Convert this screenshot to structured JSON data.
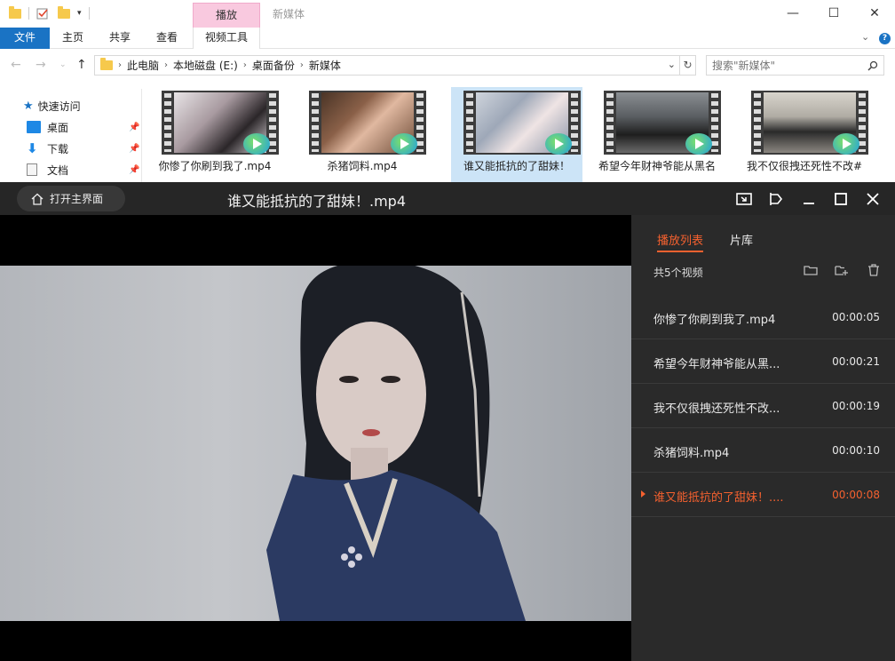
{
  "explorer": {
    "window_title": "新媒体",
    "context_tab": "播放",
    "ribbon_tabs": {
      "file": "文件",
      "home": "主页",
      "share": "共享",
      "view": "查看",
      "video_tools": "视频工具"
    },
    "breadcrumb": [
      "此电脑",
      "本地磁盘 (E:)",
      "桌面备份",
      "新媒体"
    ],
    "search_placeholder": "搜索\"新媒体\"",
    "nav": {
      "quick_access": "快速访问",
      "desktop": "桌面",
      "downloads": "下载",
      "documents": "文档"
    },
    "files": [
      {
        "label": "你惨了你刷到我了.mp4"
      },
      {
        "label": "杀猪饲料.mp4"
      },
      {
        "label": "谁又能抵抗的了甜妹！"
      },
      {
        "label": "希望今年财神爷能从黑名"
      },
      {
        "label": "我不仅很拽还死性不改#"
      }
    ]
  },
  "player": {
    "home_button": "打开主界面",
    "title": "谁又能抵抗的了甜妹！.mp4",
    "tabs": {
      "playlist": "播放列表",
      "library": "片库"
    },
    "count_text": "共5个视频",
    "playlist": [
      {
        "name": "你惨了你刷到我了.mp4",
        "duration": "00:00:05"
      },
      {
        "name": "希望今年财神爷能从黑...",
        "duration": "00:00:21"
      },
      {
        "name": "我不仅很拽还死性不改...",
        "duration": "00:00:19"
      },
      {
        "name": "杀猪饲料.mp4",
        "duration": "00:00:10"
      },
      {
        "name": "谁又能抵抗的了甜妹！....",
        "duration": "00:00:08"
      }
    ],
    "active_index": 4,
    "accent_color": "#f5612f"
  }
}
